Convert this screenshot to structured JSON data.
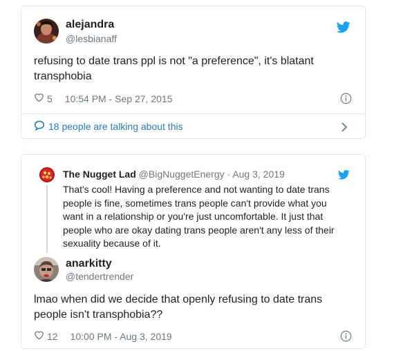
{
  "tweet1": {
    "name": "alejandra",
    "handle": "@lesbianaff",
    "text": "refusing to date trans ppl is not \"a preference\", it's blatant transphobia",
    "likes": "5",
    "timestamp": "10:54 PM - Sep 27, 2015",
    "talking": "18 people are talking about this"
  },
  "quoted": {
    "name": "The Nugget Lad",
    "handle": "@BigNuggetEnergy",
    "sep": "·",
    "date": "Aug 3, 2019",
    "text": "That's cool! Having a preference and not wanting to date trans people is fine, sometimes trans people can't provide what you want in a relationship or you're just uncomfortable. It just that people who are okay dating trans people aren't any less of their sexuality because of it."
  },
  "tweet2": {
    "name": "anarkitty",
    "handle": "@tendertrender",
    "text": "lmao when did we decide that openly refusing to date trans people isn't transphobia??",
    "likes": "12",
    "timestamp": "10:00 PM - Aug 3, 2019"
  },
  "colors": {
    "twitter_blue": "#1da1f2",
    "link_blue": "#2b7bb9",
    "meta_gray": "#697882",
    "border": "#e1e8ed"
  },
  "icons": [
    "twitter-bird-icon",
    "heart-icon",
    "info-icon",
    "speech-bubble-icon",
    "chevron-right-icon"
  ]
}
